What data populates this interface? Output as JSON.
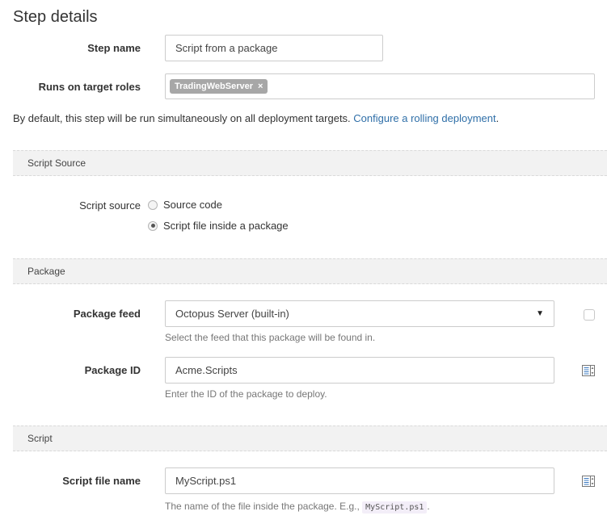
{
  "page": {
    "title": "Step details"
  },
  "step": {
    "name_label": "Step name",
    "name_value": "Script from a package",
    "roles_label": "Runs on target roles",
    "roles": [
      "TradingWebServer"
    ],
    "remove_icon": "×",
    "info_text": "By default, this step will be run simultaneously on all deployment targets. ",
    "info_link": "Configure a rolling deployment",
    "info_suffix": "."
  },
  "sections": {
    "script_source": {
      "header": "Script Source",
      "label": "Script source",
      "options": [
        {
          "label": "Source code",
          "selected": false
        },
        {
          "label": "Script file inside a package",
          "selected": true
        }
      ]
    },
    "package": {
      "header": "Package",
      "feed_label": "Package feed",
      "feed_value": "Octopus Server (built-in)",
      "feed_help": "Select the feed that this package will be found in.",
      "feed_caret": "▼",
      "id_label": "Package ID",
      "id_value": "Acme.Scripts",
      "id_help": "Enter the ID of the package to deploy."
    },
    "script": {
      "header": "Script",
      "file_label": "Script file name",
      "file_value": "MyScript.ps1",
      "file_help_prefix": "The name of the file inside the package. E.g., ",
      "file_help_code": "MyScript.ps1",
      "file_help_suffix": "."
    }
  },
  "icons": {
    "variable_binding": "variable-binding-icon",
    "checkbox": "bind-checkbox"
  }
}
